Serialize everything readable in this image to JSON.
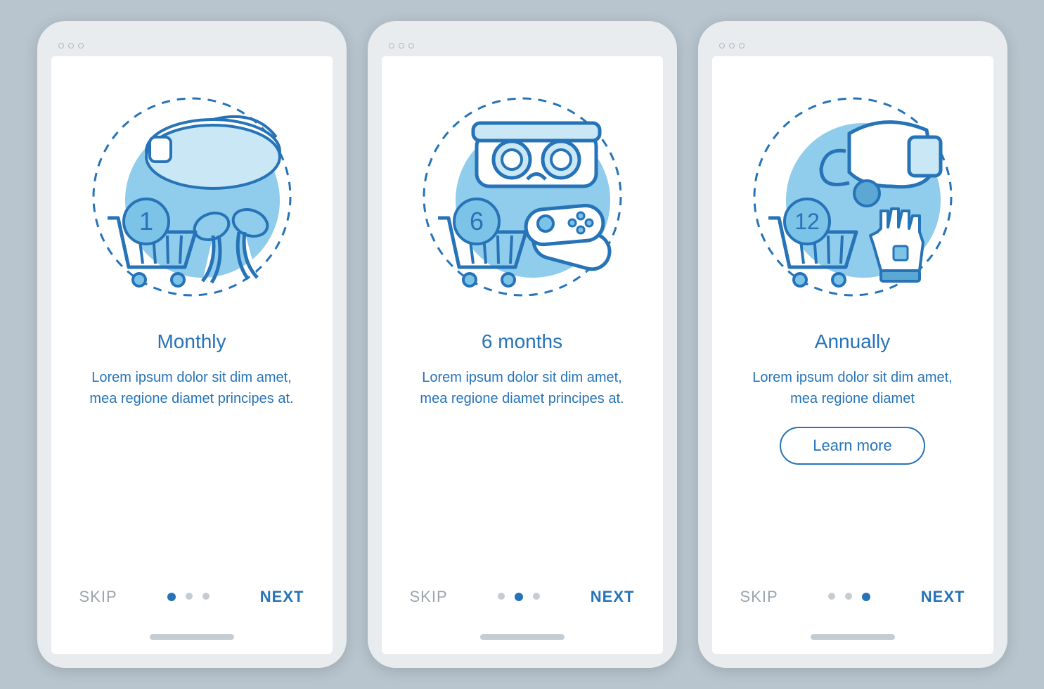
{
  "colors": {
    "primary": "#2673b8",
    "bg": "#b8c5ce",
    "muted": "#9aa5ad"
  },
  "common": {
    "skip": "SKIP",
    "next": "NEXT",
    "learn_more": "Learn more"
  },
  "screens": [
    {
      "badge": "1",
      "title": "Monthly",
      "desc": "Lorem ipsum dolor sit dim amet, mea regione diamet principes at.",
      "active_dot": 0,
      "has_learn_more": false,
      "icon": "vr-headset-controllers"
    },
    {
      "badge": "6",
      "title": "6 months",
      "desc": "Lorem ipsum dolor sit dim amet, mea regione diamet principes at.",
      "active_dot": 1,
      "has_learn_more": false,
      "icon": "vr-goggles-gamepad"
    },
    {
      "badge": "12",
      "title": "Annually",
      "desc": "Lorem ipsum dolor sit dim amet, mea regione diamet",
      "active_dot": 2,
      "has_learn_more": true,
      "icon": "vr-headset-glove"
    }
  ]
}
